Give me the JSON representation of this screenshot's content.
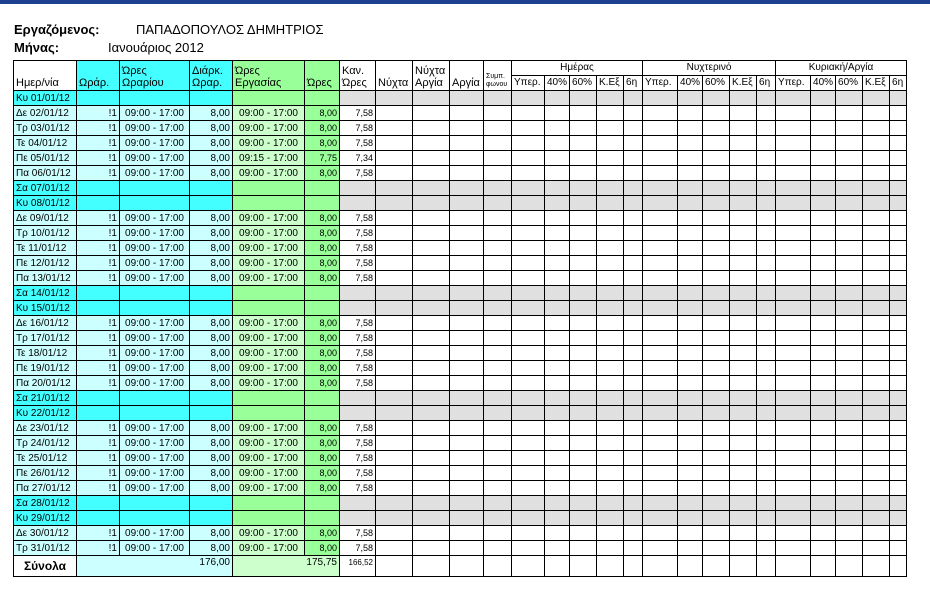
{
  "header": {
    "employee_label": "Εργαζόμενος:",
    "employee_value": "ΠΑΠΑΔΟΠΟΥΛΟΣ ΔΗΜΗΤΡΙΟΣ",
    "month_label": "Μήνας:",
    "month_value": "Ιανουάριος 2012"
  },
  "columns": {
    "date": "Ημερ/νία",
    "schedule": "Ωράρ.",
    "sched_hours": "Ώρες Ωραρίου",
    "sched_duration": "Διάρκ. Ωραρ.",
    "work_hours": "Ώρες Εργασίας",
    "hours": "Ώρες",
    "normal_hours": "Καν. Ώρες",
    "night": "Νύχτα",
    "night_holiday": "Νύχτα Αργία",
    "holiday": "Αργία",
    "agreed": "Συμπ. φωνου",
    "day_group": "Ημέρας",
    "night_group": "Νυχτερινό",
    "sunday_group": "Κυριακή/Αργία",
    "sub_over": "Υπερ.",
    "sub_40": "40%",
    "sub_60": "60%",
    "sub_ke": "Κ.Εξ",
    "sub_6": "6η"
  },
  "rows": [
    {
      "date": "Κυ 01/01/12",
      "weekend": "sun"
    },
    {
      "date": "Δε 02/01/12",
      "sched": "!1",
      "sh": "09:00 - 17:00",
      "dur": "8,00",
      "wh": "09:00 - 17:00",
      "h": "8,00",
      "kh": "7,58"
    },
    {
      "date": "Τρ 03/01/12",
      "sched": "!1",
      "sh": "09:00 - 17:00",
      "dur": "8,00",
      "wh": "09:00 - 17:00",
      "h": "8,00",
      "kh": "7,58"
    },
    {
      "date": "Τε 04/01/12",
      "sched": "!1",
      "sh": "09:00 - 17:00",
      "dur": "8,00",
      "wh": "09:00 - 17:00",
      "h": "8,00",
      "kh": "7,58"
    },
    {
      "date": "Πε 05/01/12",
      "sched": "!1",
      "sh": "09:00 - 17:00",
      "dur": "8,00",
      "wh": "09:15 - 17:00",
      "h": "7,75",
      "kh": "7,34"
    },
    {
      "date": "Πα 06/01/12",
      "sched": "!1",
      "sh": "09:00 - 17:00",
      "dur": "8,00",
      "wh": "09:00 - 17:00",
      "h": "8,00",
      "kh": "7,58"
    },
    {
      "date": "Σα 07/01/12",
      "weekend": "sat"
    },
    {
      "date": "Κυ 08/01/12",
      "weekend": "sun"
    },
    {
      "date": "Δε 09/01/12",
      "sched": "!1",
      "sh": "09:00 - 17:00",
      "dur": "8,00",
      "wh": "09:00 - 17:00",
      "h": "8,00",
      "kh": "7,58"
    },
    {
      "date": "Τρ 10/01/12",
      "sched": "!1",
      "sh": "09:00 - 17:00",
      "dur": "8,00",
      "wh": "09:00 - 17:00",
      "h": "8,00",
      "kh": "7,58"
    },
    {
      "date": "Τε 11/01/12",
      "sched": "!1",
      "sh": "09:00 - 17:00",
      "dur": "8,00",
      "wh": "09:00 - 17:00",
      "h": "8,00",
      "kh": "7,58"
    },
    {
      "date": "Πε 12/01/12",
      "sched": "!1",
      "sh": "09:00 - 17:00",
      "dur": "8,00",
      "wh": "09:00 - 17:00",
      "h": "8,00",
      "kh": "7,58"
    },
    {
      "date": "Πα 13/01/12",
      "sched": "!1",
      "sh": "09:00 - 17:00",
      "dur": "8,00",
      "wh": "09:00 - 17:00",
      "h": "8,00",
      "kh": "7,58"
    },
    {
      "date": "Σα 14/01/12",
      "weekend": "sat"
    },
    {
      "date": "Κυ 15/01/12",
      "weekend": "sun"
    },
    {
      "date": "Δε 16/01/12",
      "sched": "!1",
      "sh": "09:00 - 17:00",
      "dur": "8,00",
      "wh": "09:00 - 17:00",
      "h": "8,00",
      "kh": "7,58"
    },
    {
      "date": "Τρ 17/01/12",
      "sched": "!1",
      "sh": "09:00 - 17:00",
      "dur": "8,00",
      "wh": "09:00 - 17:00",
      "h": "8,00",
      "kh": "7,58"
    },
    {
      "date": "Τε 18/01/12",
      "sched": "!1",
      "sh": "09:00 - 17:00",
      "dur": "8,00",
      "wh": "09:00 - 17:00",
      "h": "8,00",
      "kh": "7,58"
    },
    {
      "date": "Πε 19/01/12",
      "sched": "!1",
      "sh": "09:00 - 17:00",
      "dur": "8,00",
      "wh": "09:00 - 17:00",
      "h": "8,00",
      "kh": "7,58"
    },
    {
      "date": "Πα 20/01/12",
      "sched": "!1",
      "sh": "09:00 - 17:00",
      "dur": "8,00",
      "wh": "09:00 - 17:00",
      "h": "8,00",
      "kh": "7,58"
    },
    {
      "date": "Σα 21/01/12",
      "weekend": "sat"
    },
    {
      "date": "Κυ 22/01/12",
      "weekend": "sun"
    },
    {
      "date": "Δε 23/01/12",
      "sched": "!1",
      "sh": "09:00 - 17:00",
      "dur": "8,00",
      "wh": "09:00 - 17:00",
      "h": "8,00",
      "kh": "7,58"
    },
    {
      "date": "Τρ 24/01/12",
      "sched": "!1",
      "sh": "09:00 - 17:00",
      "dur": "8,00",
      "wh": "09:00 - 17:00",
      "h": "8,00",
      "kh": "7,58"
    },
    {
      "date": "Τε 25/01/12",
      "sched": "!1",
      "sh": "09:00 - 17:00",
      "dur": "8,00",
      "wh": "09:00 - 17:00",
      "h": "8,00",
      "kh": "7,58"
    },
    {
      "date": "Πε 26/01/12",
      "sched": "!1",
      "sh": "09:00 - 17:00",
      "dur": "8,00",
      "wh": "09:00 - 17:00",
      "h": "8,00",
      "kh": "7,58"
    },
    {
      "date": "Πα 27/01/12",
      "sched": "!1",
      "sh": "09:00 - 17:00",
      "dur": "8,00",
      "wh": "09:00 - 17:00",
      "h": "8,00",
      "kh": "7,58"
    },
    {
      "date": "Σα 28/01/12",
      "weekend": "sat"
    },
    {
      "date": "Κυ 29/01/12",
      "weekend": "sun"
    },
    {
      "date": "Δε 30/01/12",
      "sched": "!1",
      "sh": "09:00 - 17:00",
      "dur": "8,00",
      "wh": "09:00 - 17:00",
      "h": "8,00",
      "kh": "7,58"
    },
    {
      "date": "Τρ 31/01/12",
      "sched": "!1",
      "sh": "09:00 - 17:00",
      "dur": "8,00",
      "wh": "09:00 - 17:00",
      "h": "8,00",
      "kh": "7,58"
    }
  ],
  "totals": {
    "label": "Σύνολα",
    "duration": "176,00",
    "hours": "175,75",
    "normal": "166,52"
  },
  "colors": {
    "cyan": "#44ffff",
    "light_cyan": "#ccffff",
    "green": "#99ff99",
    "light_green": "#ccffcc",
    "weekend_gray": "#e0e0e0",
    "title_bar": "#1c3f8f"
  }
}
